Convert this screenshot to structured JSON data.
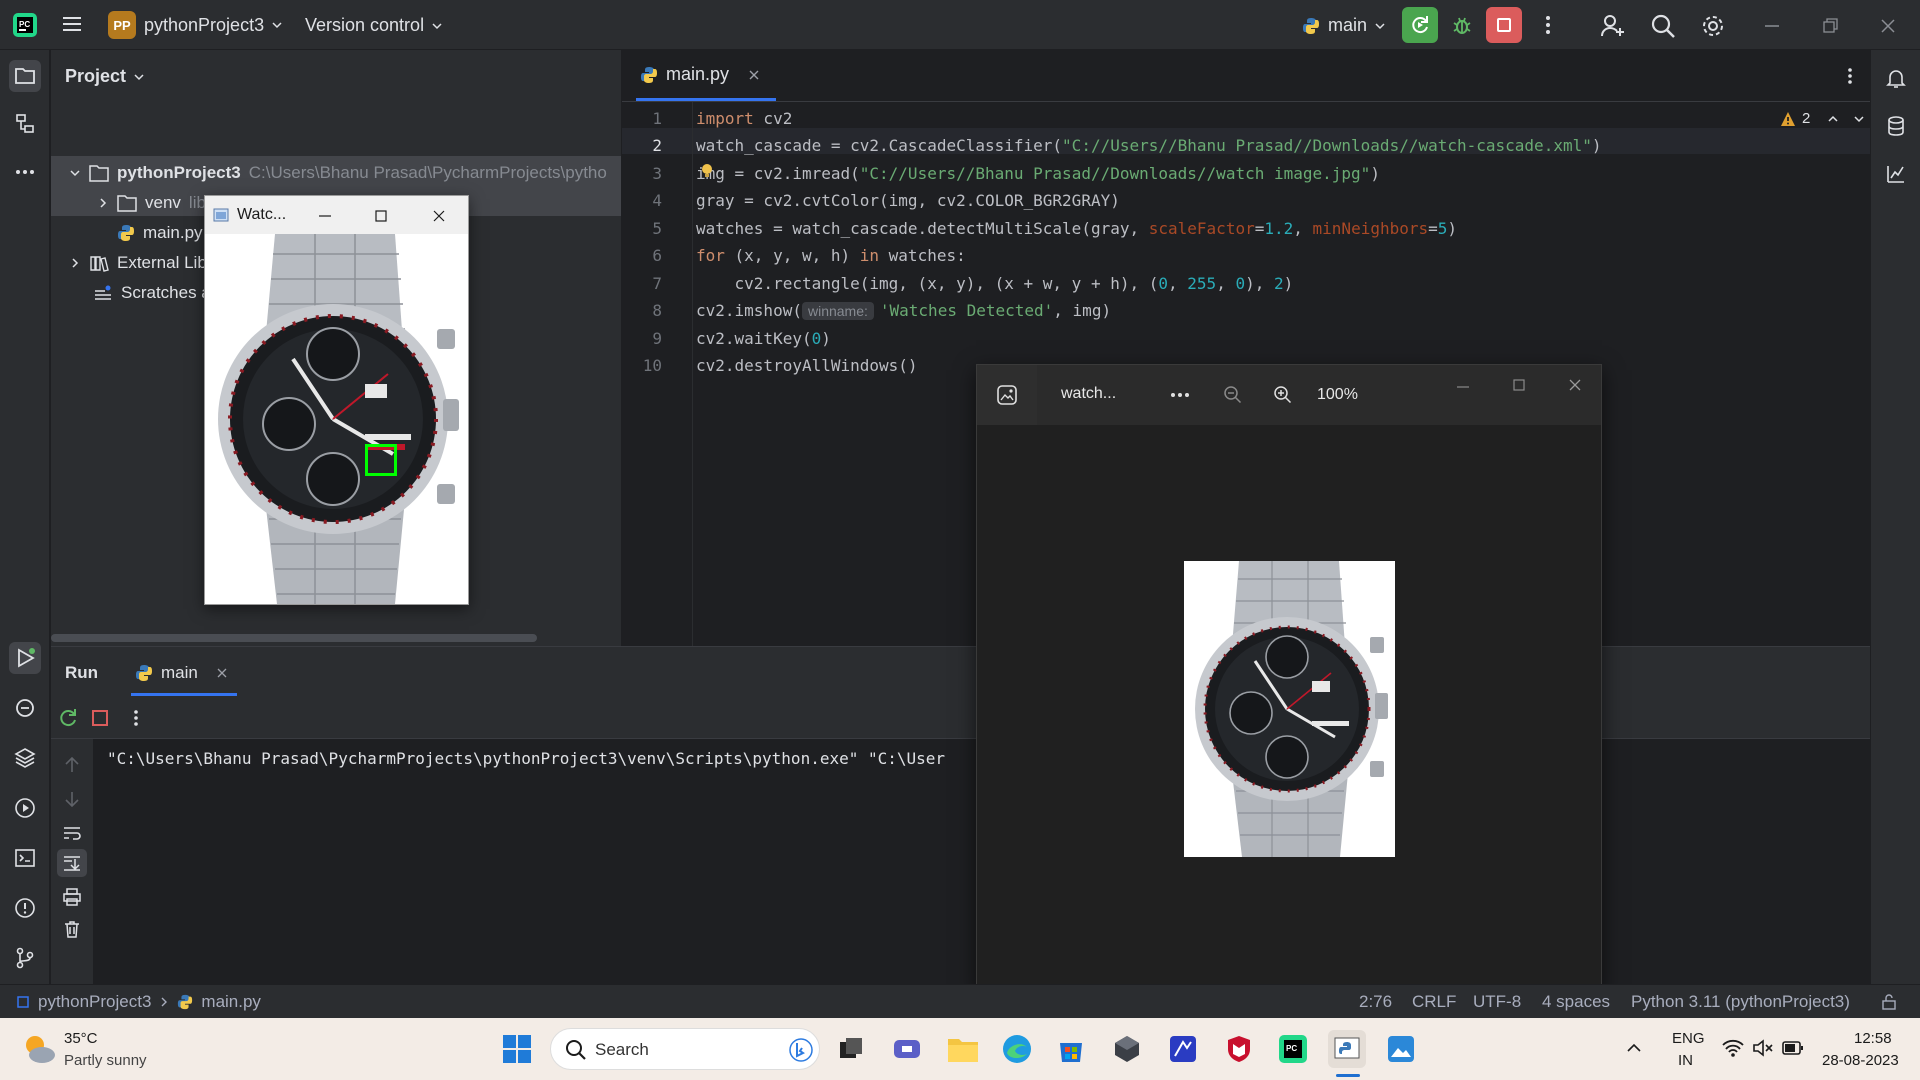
{
  "titlebar": {
    "project_badge": "PP",
    "project_name": "pythonProject3",
    "vcs": "Version control",
    "branch": "main"
  },
  "project_panel": {
    "header": "Project",
    "tree": [
      {
        "label": "pythonProject3",
        "hint": "C:\\Users\\Bhanu Prasad\\PycharmProjects\\pytho"
      },
      {
        "label": "venv",
        "hint": "library root"
      },
      {
        "label": "main.py",
        "hint": ""
      },
      {
        "label": "External Lib",
        "hint": ""
      },
      {
        "label": "Scratches a",
        "hint": ""
      }
    ]
  },
  "editor": {
    "tab_label": "main.py",
    "warnings_count": "2",
    "line_numbers": [
      "1",
      "2",
      "3",
      "4",
      "5",
      "6",
      "7",
      "8",
      "9",
      "10"
    ],
    "code": {
      "l1_kw": "import",
      "l1_rest": " cv2",
      "l2_a": "watch_cascade = cv2.CascadeClassifier(",
      "l2_str": "\"C://Users//Bhanu Prasad//Downloads//watch-cascade.xml\"",
      "l2_b": ")",
      "l3_a": "img = cv2.imread(",
      "l3_str": "\"C://Users//Bhanu Prasad//Downloads//watch image.jpg\"",
      "l3_b": ")",
      "l4": "gray = cv2.cvtColor(img, cv2.COLOR_BGR2GRAY)",
      "l5_a": "watches = watch_cascade.detectMultiScale(gray, ",
      "l5_p1": "scaleFactor",
      "l5_eq1": "=",
      "l5_n1": "1.2",
      "l5_sep": ", ",
      "l5_p2": "minNeighbors",
      "l5_eq2": "=",
      "l5_n2": "5",
      "l5_b": ")",
      "l6_kw1": "for",
      "l6_a": " (x, y, w, h) ",
      "l6_kw2": "in",
      "l6_b": " watches:",
      "l7_a": "    cv2.rectangle(img, (x, y), (x + w, y + h), (",
      "l7_n1": "0",
      "l7_c1": ", ",
      "l7_n2": "255",
      "l7_c2": ", ",
      "l7_n3": "0",
      "l7_c3": "), ",
      "l7_n4": "2",
      "l7_b": ")",
      "l8_a": "cv2.imshow(",
      "l8_hint": "winname:",
      "l8_str": "'Watches Detected'",
      "l8_b": ", img)",
      "l9_a": "cv2.waitKey(",
      "l9_n": "0",
      "l9_b": ")",
      "l10": "cv2.destroyAllWindows()"
    }
  },
  "run_panel": {
    "title": "Run",
    "tab": "main",
    "console_line": "\"C:\\Users\\Bhanu Prasad\\PycharmProjects\\pythonProject3\\venv\\Scripts\\python.exe\" \"C:\\User"
  },
  "cv_window": {
    "title": "Watc..."
  },
  "photos_window": {
    "title": "watch...",
    "zoom": "100%"
  },
  "statusbar": {
    "crumb_project": "pythonProject3",
    "crumb_file": "main.py",
    "position": "2:76",
    "line_sep": "CRLF",
    "encoding": "UTF-8",
    "indent": "4 spaces",
    "interpreter": "Python 3.11 (pythonProject3)"
  },
  "taskbar": {
    "weather_temp": "35°C",
    "weather_desc": "Partly sunny",
    "search_label": "Search",
    "lang_top": "ENG",
    "lang_bottom": "IN",
    "time": "12:58",
    "date": "28-08-2023"
  },
  "colors": {
    "accent": "#3574f0",
    "run_green": "#4aa54f",
    "stop_red": "#db5c5c",
    "detection_box": "#00ff00"
  }
}
